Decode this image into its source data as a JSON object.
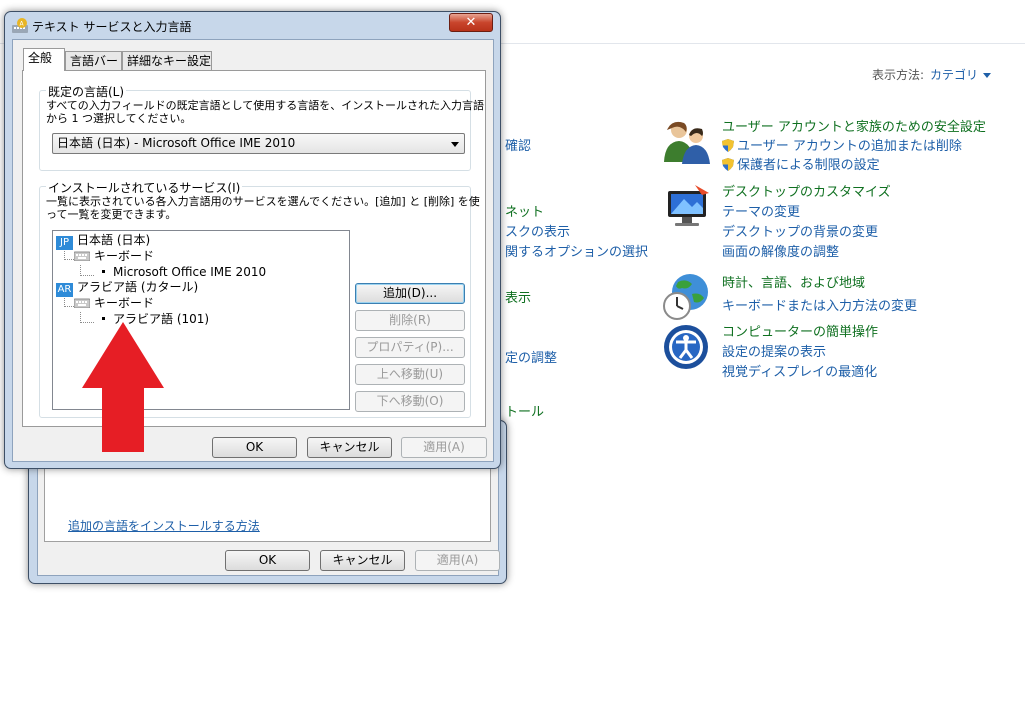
{
  "control_panel": {
    "view_by_label": "表示方法:",
    "view_by_value": "カテゴリ",
    "left_fragments": [
      "確認",
      "ネット",
      "スクの表示",
      "関するオプションの選択",
      "表示",
      "定の調整",
      "トール"
    ],
    "categories": [
      {
        "title": "ユーザー アカウントと家族のための安全設定",
        "links": [
          "ユーザー アカウントの追加または削除",
          "保護者による制限の設定"
        ]
      },
      {
        "title": "デスクトップのカスタマイズ",
        "links": [
          "テーマの変更",
          "デスクトップの背景の変更",
          "画面の解像度の調整"
        ]
      },
      {
        "title": "時計、言語、および地域",
        "links": [
          "キーボードまたは入力方法の変更"
        ]
      },
      {
        "title": "コンピューターの簡単操作",
        "links": [
          "設定の提案の表示",
          "視覚ディスプレイの最適化"
        ]
      }
    ]
  },
  "back_dialog": {
    "link": "追加の言語をインストールする方法",
    "ok": "OK",
    "cancel": "キャンセル",
    "apply": "適用(A)"
  },
  "dialog": {
    "title": "テキスト サービスと入力言語",
    "close": "✕",
    "tabs": [
      "全般",
      "言語バー",
      "詳細なキー設定"
    ],
    "default_language": {
      "label": "既定の言語(L)",
      "desc_1": "すべての入力フィールドの既定言語として使用する言語を、インストールされた入力言語",
      "desc_2": "から 1 つ選択してください。",
      "selected": "日本語 (日本) - Microsoft Office IME 2010"
    },
    "installed_services": {
      "label": "インストールされているサービス(I)",
      "desc_1": "一覧に表示されている各入力言語用のサービスを選んでください。[追加] と [削除] を使",
      "desc_2": "って一覧を変更できます。",
      "tree": [
        {
          "badge": "JP",
          "language": "日本語 (日本)",
          "category": "キーボード",
          "item": "Microsoft Office IME 2010"
        },
        {
          "badge": "AR",
          "language": "アラビア語 (カタール)",
          "category": "キーボード",
          "item": "アラビア語 (101)"
        }
      ],
      "buttons": {
        "add": "追加(D)...",
        "remove": "削除(R)",
        "properties": "プロパティ(P)...",
        "move_up": "上へ移動(U)",
        "move_down": "下へ移動(O)"
      }
    },
    "footer": {
      "ok": "OK",
      "cancel": "キャンセル",
      "apply": "適用(A)"
    }
  },
  "colors": {
    "arrow": "#e61e25",
    "link": "#1e5fa8",
    "category_title": "#0f7020"
  }
}
